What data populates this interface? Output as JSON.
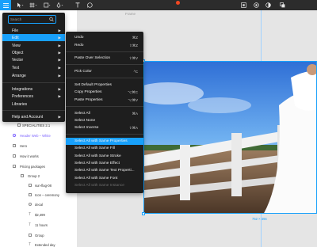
{
  "search": {
    "placeholder": "Search"
  },
  "main_menu": {
    "items": [
      {
        "label": "File",
        "arrow": "▶"
      },
      {
        "label": "Edit",
        "arrow": "▶",
        "active": true
      },
      {
        "label": "View",
        "arrow": "▶"
      },
      {
        "label": "Object",
        "arrow": "▶"
      },
      {
        "label": "Vector",
        "arrow": "▶"
      },
      {
        "label": "Text",
        "arrow": "▶"
      },
      {
        "label": "Arrange",
        "arrow": "▶"
      },
      {
        "label": "Integrations",
        "arrow": "▶"
      },
      {
        "label": "Preferences",
        "arrow": "▶"
      },
      {
        "label": "Libraries",
        "arrow": ""
      },
      {
        "label": "Help and Account",
        "arrow": "▶"
      }
    ]
  },
  "edit_menu": {
    "items": [
      {
        "label": "Undo",
        "shortcut": "⌘Z"
      },
      {
        "label": "Redo",
        "shortcut": "⇧⌘Z"
      },
      {
        "label": "Paste Over Selection",
        "shortcut": "⇧⌘V"
      },
      {
        "label": "Pick Color",
        "shortcut": "^C"
      },
      {
        "label": "Set Default Properties",
        "shortcut": ""
      },
      {
        "label": "Copy Properties",
        "shortcut": "⌥⌘C"
      },
      {
        "label": "Paste Properties",
        "shortcut": "⌥⌘V"
      },
      {
        "label": "Select All",
        "shortcut": "⌘A"
      },
      {
        "label": "Select None",
        "shortcut": ""
      },
      {
        "label": "Select Inverse",
        "shortcut": "⇧⌘A"
      },
      {
        "label": "Select All with Same Properties",
        "shortcut": "",
        "active": true
      },
      {
        "label": "Select All with Same Fill",
        "shortcut": ""
      },
      {
        "label": "Select All with Same Stroke",
        "shortcut": ""
      },
      {
        "label": "Select All with Same Effect",
        "shortcut": ""
      },
      {
        "label": "Select All with Same Text Properti...",
        "shortcut": ""
      },
      {
        "label": "Select All with Same Font",
        "shortcut": ""
      },
      {
        "label": "Select All with Same Instance",
        "shortcut": "",
        "disabled": true
      }
    ]
  },
  "layers": {
    "items": [
      {
        "label": "SPECIALITIES 2.1",
        "kind": "frame"
      },
      {
        "label": "Header Web – White",
        "kind": "component"
      },
      {
        "label": "Hero",
        "kind": "frame"
      },
      {
        "label": "How it works",
        "kind": "frame"
      },
      {
        "label": "Pricing packages",
        "kind": "frame"
      },
      {
        "label": "Group 2",
        "kind": "frame"
      },
      {
        "label": "sun-flag-08",
        "kind": "frame"
      },
      {
        "label": "Icon – ceremony",
        "kind": "frame"
      },
      {
        "label": "decal",
        "kind": "ring"
      },
      {
        "label": "$2,499",
        "kind": "text"
      },
      {
        "label": "11 hours",
        "kind": "text"
      },
      {
        "label": "Group",
        "kind": "frame"
      },
      {
        "label": "Extended day",
        "kind": "text"
      }
    ]
  },
  "canvas": {
    "frame_label": "Frame",
    "selection_size": "752 × 494"
  },
  "colors": {
    "accent": "#18a0fb",
    "menu_bg": "#1e1e1e",
    "toolbar_bg": "#2c2c2c",
    "component": "#7b61ff"
  }
}
